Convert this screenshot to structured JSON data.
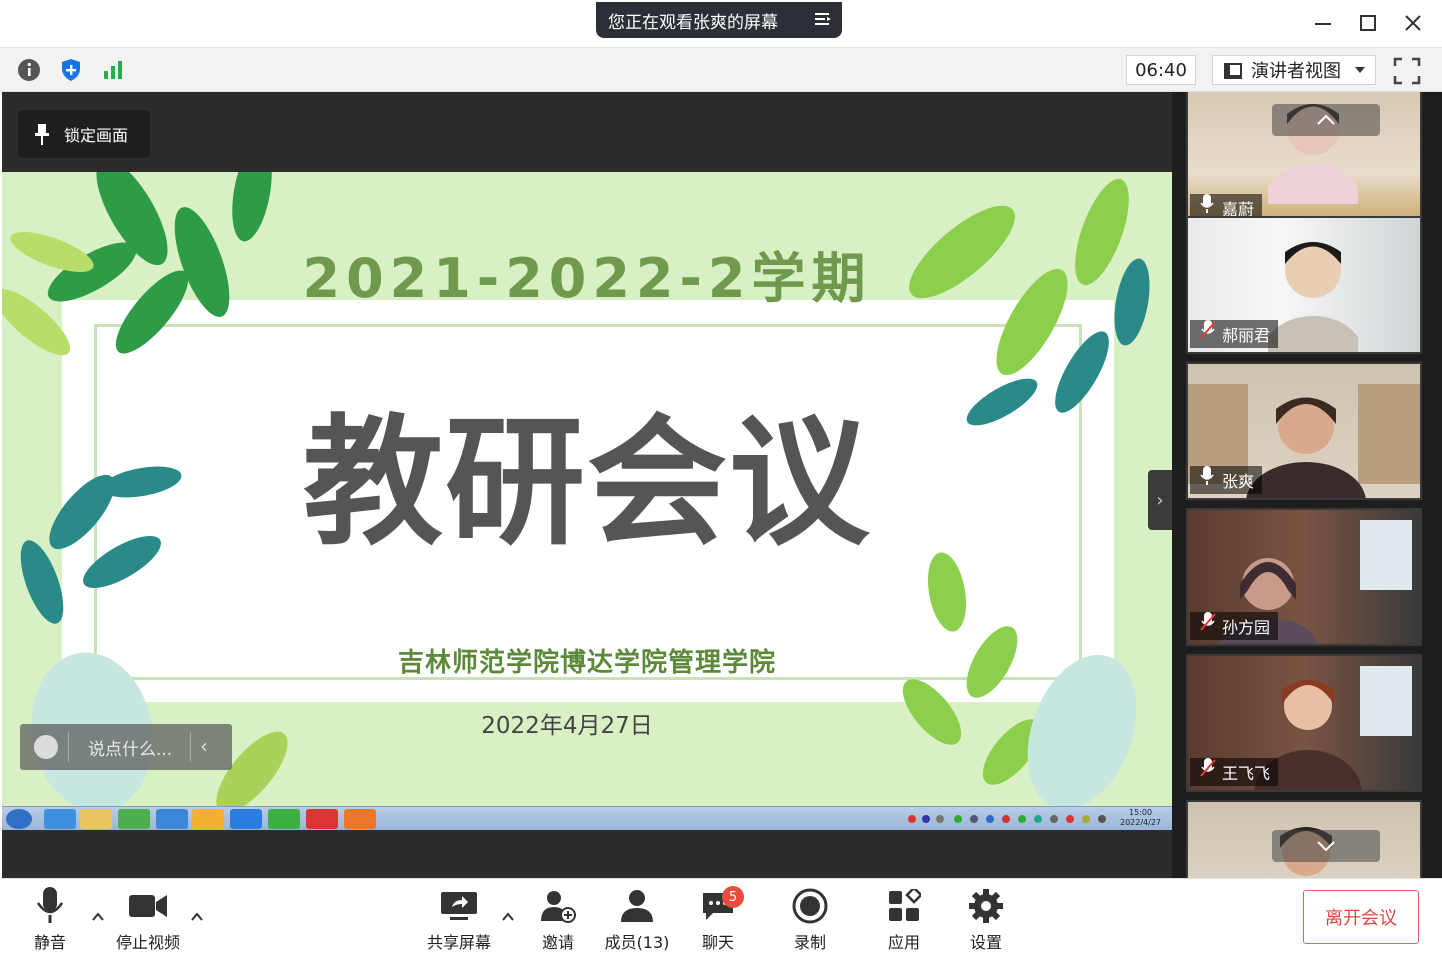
{
  "window": {
    "share_banner": "您正在观看张爽的屏幕"
  },
  "toolbar": {
    "timer": "06:40",
    "view_mode": "演讲者视图"
  },
  "share": {
    "lock_label": "锁定画面",
    "comment_placeholder": "说点什么...",
    "slide": {
      "year": "2021-2022-2学期",
      "title": "教研会议",
      "org": "吉林师范学院博达学院管理学院",
      "date": "2022年4月27日"
    },
    "taskbar_time": "15:00",
    "taskbar_date": "2022/4/27"
  },
  "participants": [
    {
      "name": "嘉蔚",
      "muted": false
    },
    {
      "name": "郝丽君",
      "muted": true
    },
    {
      "name": "张爽",
      "muted": false
    },
    {
      "name": "孙方园",
      "muted": true
    },
    {
      "name": "王飞飞",
      "muted": true
    }
  ],
  "bottom": {
    "mute": "静音",
    "stop_video": "停止视频",
    "share_screen": "共享屏幕",
    "invite": "邀请",
    "members": "成员(13)",
    "chat": "聊天",
    "chat_badge": "5",
    "record": "录制",
    "apps": "应用",
    "settings": "设置",
    "leave": "离开会议"
  },
  "colors": {
    "leave_red": "#e04545",
    "slide_green": "#6f9a4d",
    "badge_red": "#e74c3c"
  }
}
